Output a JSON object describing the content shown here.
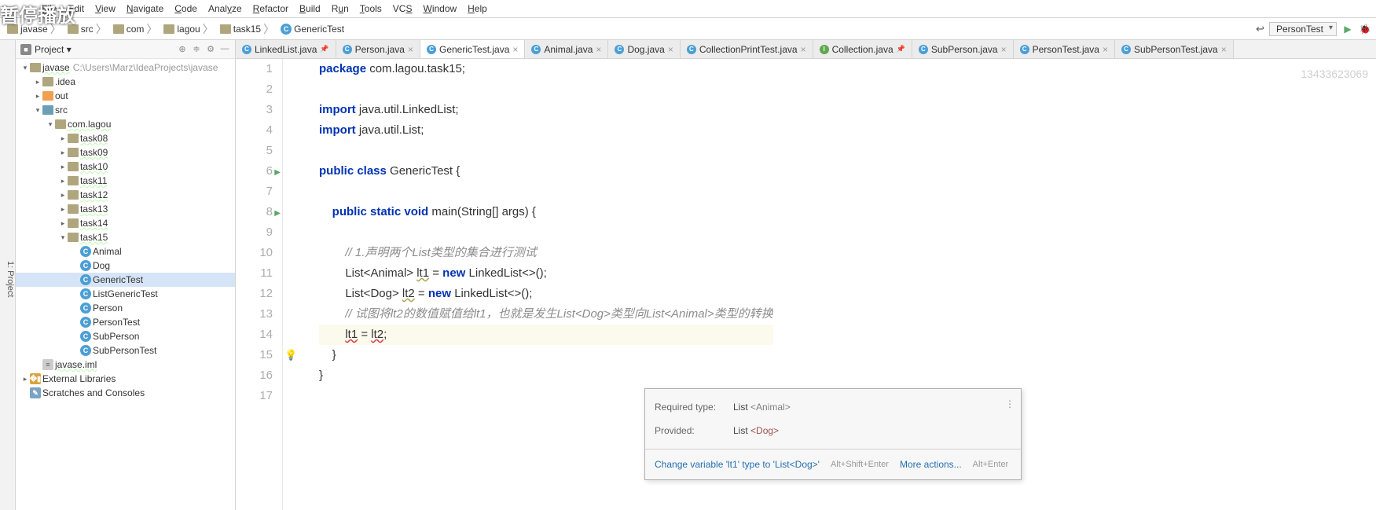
{
  "overlay": "暂停播放",
  "menu": [
    "File",
    "Edit",
    "View",
    "Navigate",
    "Code",
    "Analyze",
    "Refactor",
    "Build",
    "Run",
    "Tools",
    "VCS",
    "Window",
    "Help"
  ],
  "menu_underline_idx": [
    0,
    0,
    0,
    0,
    0,
    4,
    0,
    0,
    1,
    0,
    2,
    0,
    0
  ],
  "breadcrumb": [
    {
      "label": "javase",
      "type": "folder"
    },
    {
      "label": "src",
      "type": "folder-blue"
    },
    {
      "label": "com",
      "type": "folder"
    },
    {
      "label": "lagou",
      "type": "folder"
    },
    {
      "label": "task15",
      "type": "folder"
    },
    {
      "label": "GenericTest",
      "type": "class"
    }
  ],
  "run_config": "PersonTest",
  "watermark": "13433623069",
  "panel": {
    "title": "Project"
  },
  "tree": [
    {
      "depth": 0,
      "arrow": "▾",
      "icon": "folder",
      "label": "javase",
      "path": "C:\\Users\\Marz\\IdeaProjects\\javase",
      "wavy": true
    },
    {
      "depth": 1,
      "arrow": "▸",
      "icon": "folder",
      "label": ".idea"
    },
    {
      "depth": 1,
      "arrow": "▸",
      "icon": "folder-orange",
      "label": "out"
    },
    {
      "depth": 1,
      "arrow": "▾",
      "icon": "folder-blue",
      "label": "src"
    },
    {
      "depth": 2,
      "arrow": "▾",
      "icon": "folder",
      "label": "com.lagou",
      "wavy": true
    },
    {
      "depth": 3,
      "arrow": "▸",
      "icon": "folder",
      "label": "task08",
      "wavy": true
    },
    {
      "depth": 3,
      "arrow": "▸",
      "icon": "folder",
      "label": "task09",
      "wavy": true
    },
    {
      "depth": 3,
      "arrow": "▸",
      "icon": "folder",
      "label": "task10",
      "wavy": true
    },
    {
      "depth": 3,
      "arrow": "▸",
      "icon": "folder",
      "label": "task11",
      "wavy": true
    },
    {
      "depth": 3,
      "arrow": "▸",
      "icon": "folder",
      "label": "task12",
      "wavy": true
    },
    {
      "depth": 3,
      "arrow": "▸",
      "icon": "folder",
      "label": "task13",
      "wavy": true
    },
    {
      "depth": 3,
      "arrow": "▸",
      "icon": "folder",
      "label": "task14",
      "wavy": true
    },
    {
      "depth": 3,
      "arrow": "▾",
      "icon": "folder",
      "label": "task15",
      "wavy": true
    },
    {
      "depth": 4,
      "arrow": "",
      "icon": "class",
      "label": "Animal"
    },
    {
      "depth": 4,
      "arrow": "",
      "icon": "class",
      "label": "Dog"
    },
    {
      "depth": 4,
      "arrow": "",
      "icon": "class",
      "label": "GenericTest",
      "selected": true
    },
    {
      "depth": 4,
      "arrow": "",
      "icon": "class",
      "label": "ListGenericTest"
    },
    {
      "depth": 4,
      "arrow": "",
      "icon": "class",
      "label": "Person"
    },
    {
      "depth": 4,
      "arrow": "",
      "icon": "class",
      "label": "PersonTest"
    },
    {
      "depth": 4,
      "arrow": "",
      "icon": "class",
      "label": "SubPerson"
    },
    {
      "depth": 4,
      "arrow": "",
      "icon": "class",
      "label": "SubPersonTest"
    },
    {
      "depth": 1,
      "arrow": "",
      "icon": "file",
      "label": "javase.iml",
      "wavy": true
    },
    {
      "depth": 0,
      "arrow": "▸",
      "icon": "lib",
      "label": "External Libraries"
    },
    {
      "depth": 0,
      "arrow": "",
      "icon": "scratch",
      "label": "Scratches and Consoles"
    }
  ],
  "tabs": [
    {
      "label": "LinkedList.java",
      "icon": "class",
      "pinned": true
    },
    {
      "label": "Person.java",
      "icon": "class"
    },
    {
      "label": "GenericTest.java",
      "icon": "class",
      "active": true
    },
    {
      "label": "Animal.java",
      "icon": "class"
    },
    {
      "label": "Dog.java",
      "icon": "class"
    },
    {
      "label": "CollectionPrintTest.java",
      "icon": "class"
    },
    {
      "label": "Collection.java",
      "icon": "iface",
      "pinned": true
    },
    {
      "label": "SubPerson.java",
      "icon": "class"
    },
    {
      "label": "PersonTest.java",
      "icon": "class"
    },
    {
      "label": "SubPersonTest.java",
      "icon": "class"
    }
  ],
  "code_lines": [
    {
      "n": 1,
      "html": "<span class='kw'>package</span> com.lagou.task15;"
    },
    {
      "n": 2,
      "html": ""
    },
    {
      "n": 3,
      "html": "<span class='kw'>import</span> java.util.LinkedList;"
    },
    {
      "n": 4,
      "html": "<span class='kw'>import</span> java.util.List;"
    },
    {
      "n": 5,
      "html": ""
    },
    {
      "n": 6,
      "html": "<span class='kw'>public class</span> GenericTest {",
      "run": true
    },
    {
      "n": 7,
      "html": ""
    },
    {
      "n": 8,
      "html": "    <span class='kw'>public static void</span> main(String[] args) {",
      "run": true
    },
    {
      "n": 9,
      "html": ""
    },
    {
      "n": 10,
      "html": "        <span class='cmt'>// 1.声明两个List类型的集合进行测试</span>"
    },
    {
      "n": 11,
      "html": "        List&lt;Animal&gt; <span class='warn'>lt1</span> = <span class='kw'>new</span> LinkedList&lt;&gt;();"
    },
    {
      "n": 12,
      "html": "        List&lt;Dog&gt; <span class='warn'>lt2</span> = <span class='kw'>new</span> LinkedList&lt;&gt;();"
    },
    {
      "n": 13,
      "html": "        <span class='cmt'>// 试图将lt2的数值赋值给lt1，也就是发生List&lt;Dog&gt;类型向List&lt;Animal&gt;类型的转换</span>"
    },
    {
      "n": 14,
      "html": "        <span class='err'>lt1</span> = <span class='err'>lt2</span>;",
      "hl": true,
      "bulb": true
    },
    {
      "n": 15,
      "html": "    }"
    },
    {
      "n": 16,
      "html": "}"
    },
    {
      "n": 17,
      "html": ""
    }
  ],
  "tooltip": {
    "required_lbl": "Required type:",
    "required_val": "List",
    "required_gen": "<Animal>",
    "provided_lbl": "Provided:",
    "provided_val": "List",
    "provided_gen": "<Dog>",
    "action1": "Change variable 'lt1' type to 'List<Dog>'",
    "hint1": "Alt+Shift+Enter",
    "action2": "More actions...",
    "hint2": "Alt+Enter"
  },
  "left_rail": "1: Project"
}
